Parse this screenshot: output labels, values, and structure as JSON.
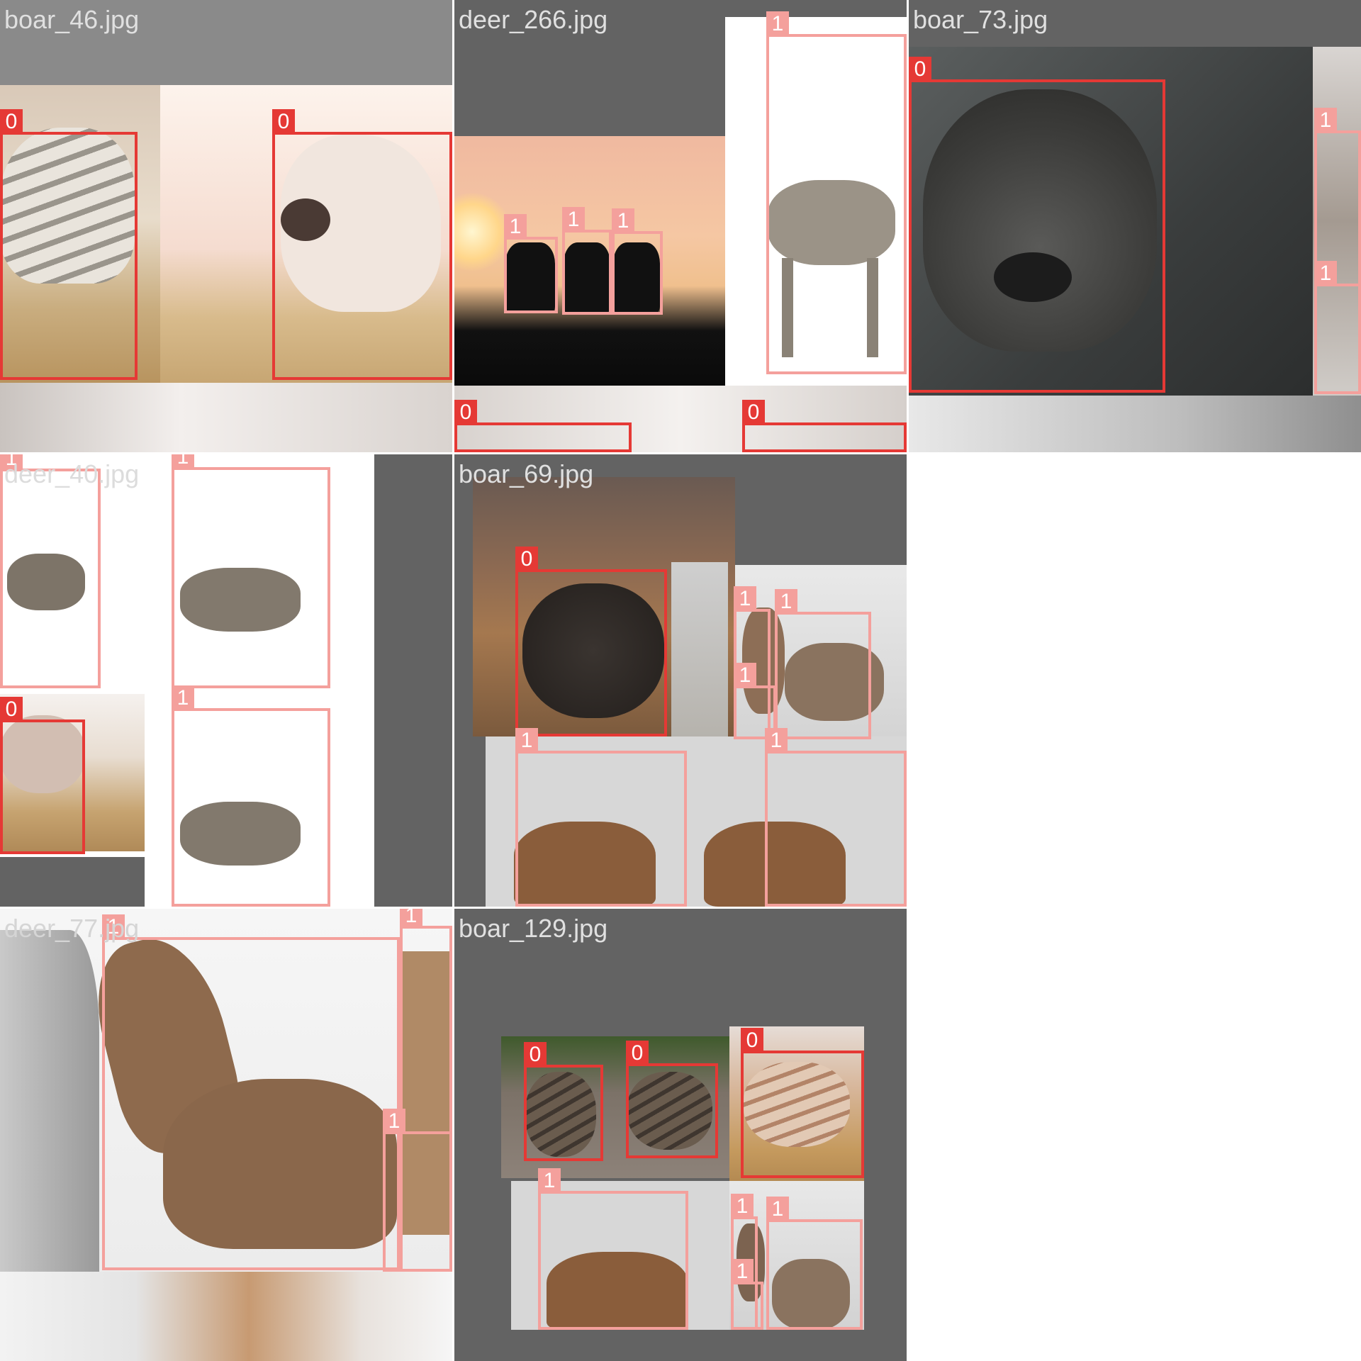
{
  "colors": {
    "boar_box": "#e53935",
    "deer_box": "#f4a09c",
    "letterbox_gray": "#636363",
    "title_text": "#e0e0e0"
  },
  "class_labels": {
    "boar": "0",
    "deer": "1"
  },
  "tiles": [
    {
      "title": "boar_46.jpg"
    },
    {
      "title": "deer_266.jpg"
    },
    {
      "title": "boar_73.jpg"
    },
    {
      "title": "deer_40.jpg"
    },
    {
      "title": "boar_69.jpg"
    },
    {
      "title": "deer_77.jpg"
    },
    {
      "title": "boar_129.jpg"
    }
  ]
}
